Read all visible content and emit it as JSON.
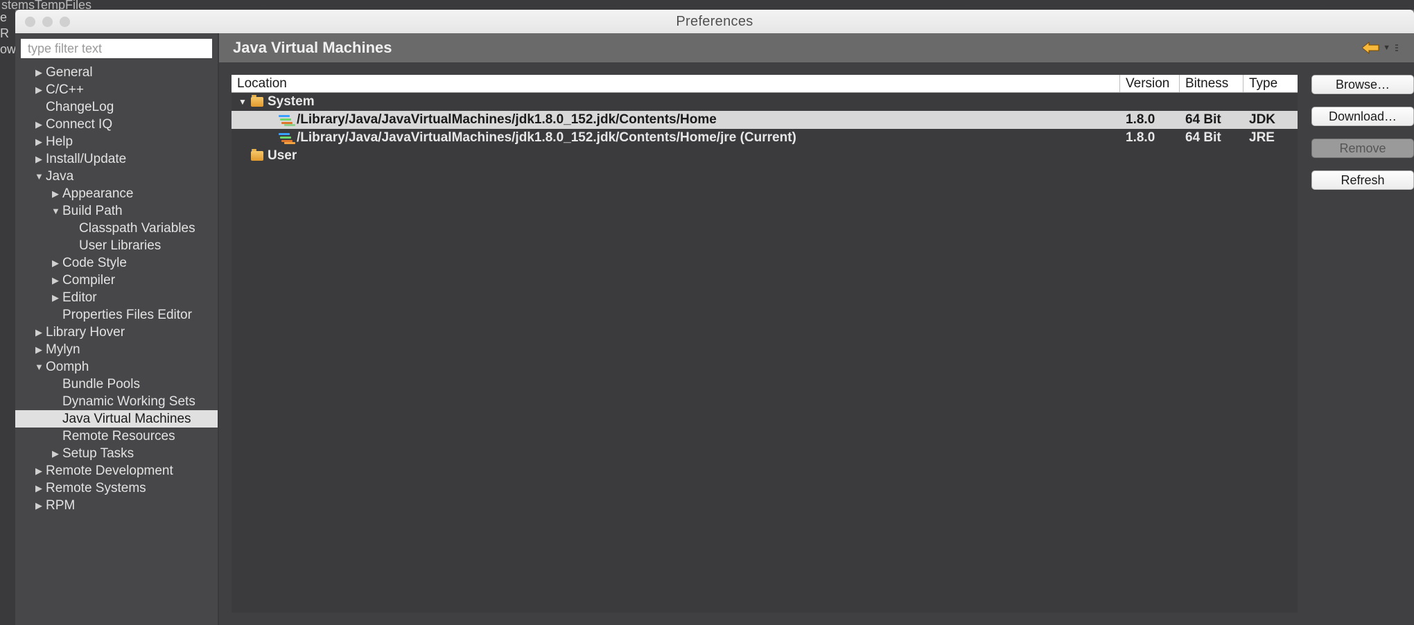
{
  "background": {
    "top_strip": "stemsTempFiles",
    "left_partial": [
      "e",
      "R",
      "owe"
    ]
  },
  "window": {
    "title": "Preferences"
  },
  "sidebar": {
    "filter_placeholder": "type filter text",
    "tree": [
      {
        "label": "General",
        "indent": 0,
        "arrow": "right"
      },
      {
        "label": "C/C++",
        "indent": 0,
        "arrow": "right"
      },
      {
        "label": "ChangeLog",
        "indent": 0,
        "arrow": "blank"
      },
      {
        "label": "Connect IQ",
        "indent": 0,
        "arrow": "right"
      },
      {
        "label": "Help",
        "indent": 0,
        "arrow": "right"
      },
      {
        "label": "Install/Update",
        "indent": 0,
        "arrow": "right"
      },
      {
        "label": "Java",
        "indent": 0,
        "arrow": "down"
      },
      {
        "label": "Appearance",
        "indent": 1,
        "arrow": "right"
      },
      {
        "label": "Build Path",
        "indent": 1,
        "arrow": "down"
      },
      {
        "label": "Classpath Variables",
        "indent": 2,
        "arrow": "blank"
      },
      {
        "label": "User Libraries",
        "indent": 2,
        "arrow": "blank"
      },
      {
        "label": "Code Style",
        "indent": 1,
        "arrow": "right"
      },
      {
        "label": "Compiler",
        "indent": 1,
        "arrow": "right"
      },
      {
        "label": "Editor",
        "indent": 1,
        "arrow": "right"
      },
      {
        "label": "Properties Files Editor",
        "indent": 1,
        "arrow": "blank"
      },
      {
        "label": "Library Hover",
        "indent": 0,
        "arrow": "right"
      },
      {
        "label": "Mylyn",
        "indent": 0,
        "arrow": "right"
      },
      {
        "label": "Oomph",
        "indent": 0,
        "arrow": "down"
      },
      {
        "label": "Bundle Pools",
        "indent": 1,
        "arrow": "blank"
      },
      {
        "label": "Dynamic Working Sets",
        "indent": 1,
        "arrow": "blank"
      },
      {
        "label": "Java Virtual Machines",
        "indent": 1,
        "arrow": "blank",
        "selected": true
      },
      {
        "label": "Remote Resources",
        "indent": 1,
        "arrow": "blank"
      },
      {
        "label": "Setup Tasks",
        "indent": 1,
        "arrow": "right"
      },
      {
        "label": "Remote Development",
        "indent": 0,
        "arrow": "right"
      },
      {
        "label": "Remote Systems",
        "indent": 0,
        "arrow": "right"
      },
      {
        "label": "RPM",
        "indent": 0,
        "arrow": "right"
      }
    ]
  },
  "main": {
    "heading": "Java Virtual Machines",
    "table": {
      "columns": {
        "location": "Location",
        "version": "Version",
        "bitness": "Bitness",
        "type": "Type"
      },
      "rows": [
        {
          "kind": "folder",
          "level": 0,
          "arrow": "down",
          "location": "System"
        },
        {
          "kind": "jdk",
          "level": 1,
          "arrow": "blank",
          "selected": true,
          "badge": "b",
          "location": "/Library/Java/JavaVirtualMachines/jdk1.8.0_152.jdk/Contents/Home",
          "version": "1.8.0",
          "bitness": "64 Bit",
          "type": "JDK"
        },
        {
          "kind": "jdk",
          "level": 1,
          "arrow": "blank",
          "badge": "o",
          "location": "/Library/Java/JavaVirtualMachines/jdk1.8.0_152.jdk/Contents/Home/jre (Current)",
          "version": "1.8.0",
          "bitness": "64 Bit",
          "type": "JRE"
        },
        {
          "kind": "folder",
          "level": 0,
          "arrow": "blank",
          "location": "User"
        }
      ]
    },
    "buttons": {
      "browse": "Browse…",
      "download": "Download…",
      "remove": "Remove",
      "refresh": "Refresh"
    }
  }
}
